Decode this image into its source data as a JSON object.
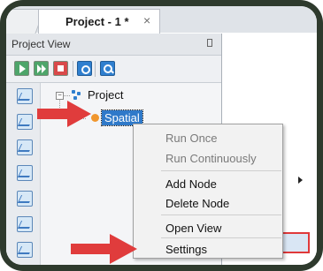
{
  "tab": {
    "title": "Project - 1 *",
    "close": "×"
  },
  "panel": {
    "title": "Project View"
  },
  "tree": {
    "root": "Project",
    "child": "Spatial",
    "expander": "−"
  },
  "context_menu": {
    "items": [
      "Run Once",
      "Run Continuously",
      "Add Node",
      "Delete Node",
      "Open View",
      "Settings"
    ]
  },
  "colors": {
    "frame": "#2e3a2d",
    "selection": "#2f79c9",
    "highlight_border": "#e0393a",
    "arrow": "#e03c3c"
  }
}
